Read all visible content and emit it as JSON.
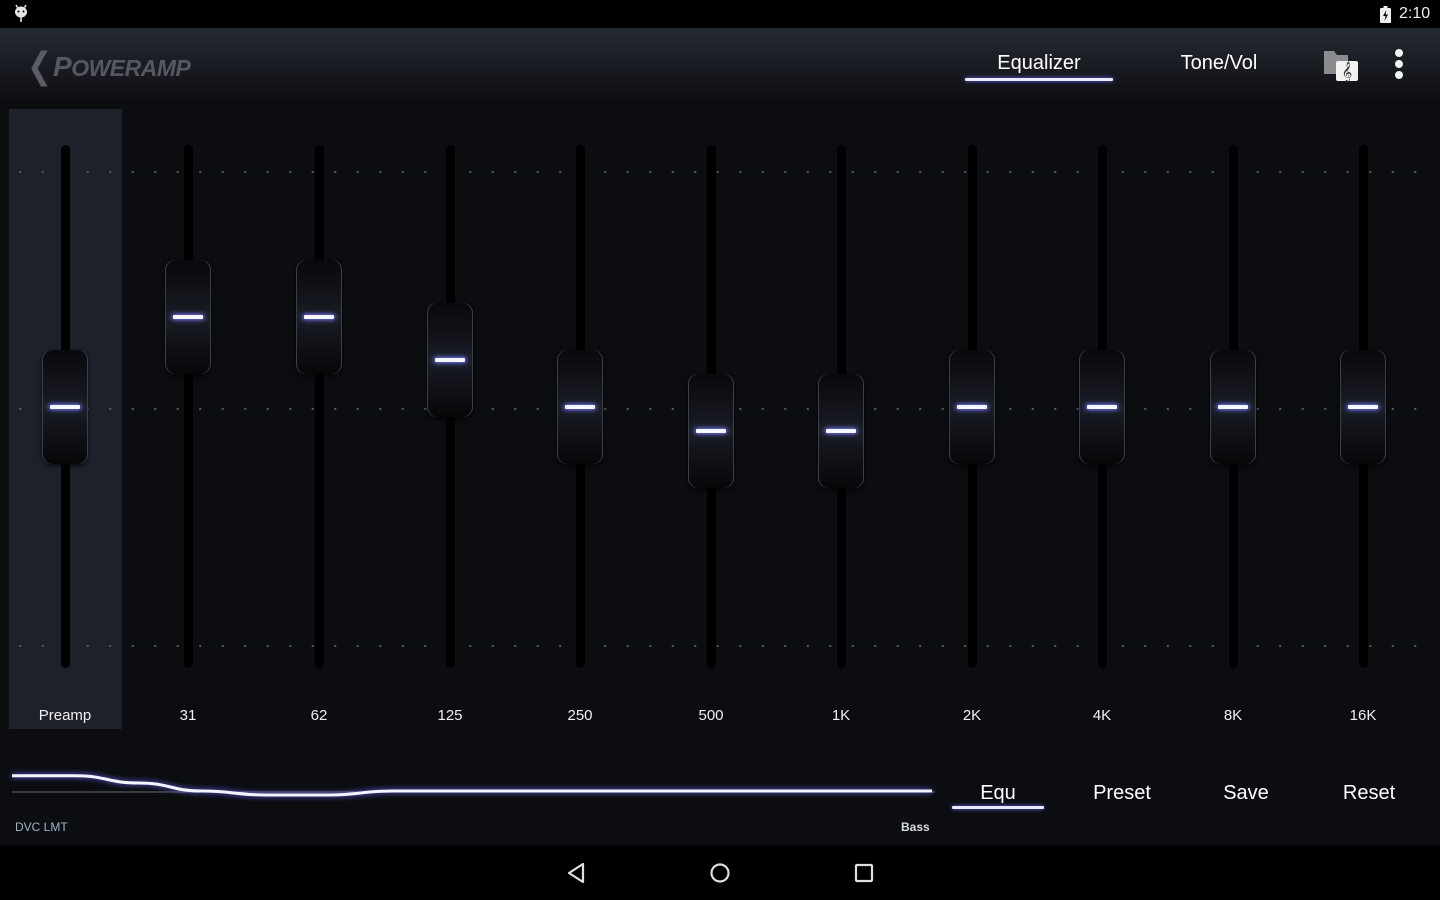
{
  "status_bar": {
    "left_icon": "android-debug-icon",
    "battery_icon": "battery-charging-icon",
    "time": "2:10"
  },
  "app_bar": {
    "back_icon": "chevron-left-icon",
    "logo_first": "P",
    "logo_rest": "OWERAMP",
    "tabs": [
      {
        "label": "Equalizer",
        "active": true
      },
      {
        "label": "Tone/Vol",
        "active": false
      }
    ],
    "folder_icon": "music-folder-icon",
    "more_icon": "more-vert-icon"
  },
  "equalizer": {
    "unit": "dB",
    "range_db": [
      -15,
      15
    ],
    "bands": [
      {
        "label": "Preamp",
        "value_db": 0,
        "selected": true
      },
      {
        "label": "31",
        "value_db": 5.7
      },
      {
        "label": "62",
        "value_db": 5.7
      },
      {
        "label": "125",
        "value_db": 3.0
      },
      {
        "label": "250",
        "value_db": 0
      },
      {
        "label": "500",
        "value_db": -1.5
      },
      {
        "label": "1K",
        "value_db": -1.5
      },
      {
        "label": "2K",
        "value_db": 0
      },
      {
        "label": "4K",
        "value_db": 0
      },
      {
        "label": "8K",
        "value_db": 0
      },
      {
        "label": "16K",
        "value_db": 0
      }
    ]
  },
  "bottom": {
    "dvc_label": "DVC LMT",
    "bass_label": "Bass",
    "buttons": [
      {
        "label": "Equ",
        "active": true
      },
      {
        "label": "Preset"
      },
      {
        "label": "Save"
      },
      {
        "label": "Reset"
      }
    ]
  },
  "nav_bar": {
    "back": "back-triangle-icon",
    "home": "home-circle-icon",
    "recents": "recents-square-icon"
  },
  "colors": {
    "accent_glow": "#7677ff",
    "accent_line": "#f6f6ff",
    "background": "#0b0d11",
    "preamp_bg": "#1e212a"
  }
}
